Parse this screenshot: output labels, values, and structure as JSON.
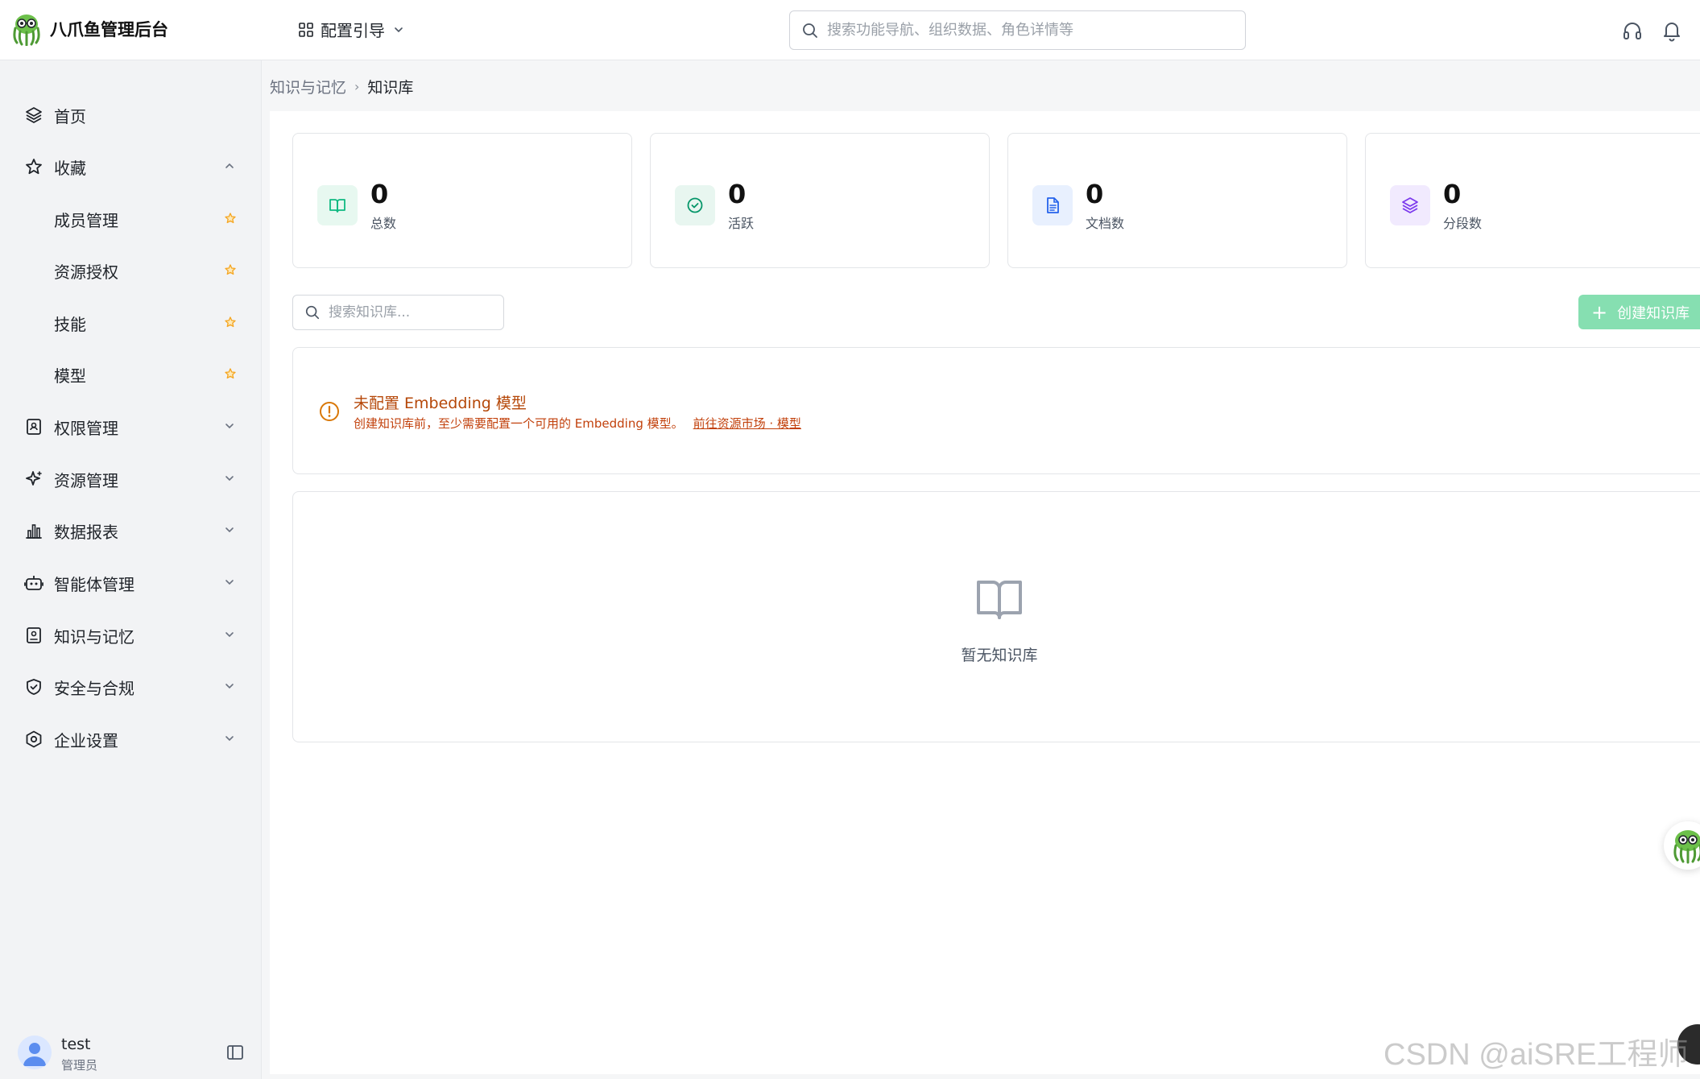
{
  "app": {
    "title": "八爪鱼管理后台",
    "brand_color": "#5cc36b"
  },
  "header": {
    "guide_label": "配置引导",
    "search_placeholder": "搜索功能导航、组织数据、角色详情等",
    "icons": [
      "grid-icon",
      "headset-icon",
      "bell-icon"
    ]
  },
  "sidebar": {
    "items": [
      {
        "label": "首页",
        "icon": "layers-icon"
      },
      {
        "label": "收藏",
        "icon": "star-icon",
        "expanded": true
      },
      {
        "label": "成员管理",
        "sub": true,
        "starred": true
      },
      {
        "label": "资源授权",
        "sub": true,
        "starred": true
      },
      {
        "label": "技能",
        "sub": true,
        "starred": true
      },
      {
        "label": "模型",
        "sub": true,
        "starred": true
      },
      {
        "label": "权限管理",
        "icon": "id-badge-icon"
      },
      {
        "label": "资源管理",
        "icon": "sparkle-icon"
      },
      {
        "label": "数据报表",
        "icon": "bar-chart-icon"
      },
      {
        "label": "智能体管理",
        "icon": "robot-icon"
      },
      {
        "label": "知识与记忆",
        "icon": "knowledge-icon"
      },
      {
        "label": "安全与合规",
        "icon": "shield-icon"
      },
      {
        "label": "企业设置",
        "icon": "hexagon-gear-icon"
      }
    ],
    "user": {
      "name": "test",
      "role": "管理员"
    }
  },
  "breadcrumb": {
    "parent": "知识与记忆",
    "current": "知识库"
  },
  "stats": [
    {
      "value": "0",
      "label": "总数",
      "icon": "book-icon",
      "color": "#10b981",
      "bg": "#e7f8f0"
    },
    {
      "value": "0",
      "label": "活跃",
      "icon": "check-circle-icon",
      "color": "#059669",
      "bg": "#e8f6f0"
    },
    {
      "value": "0",
      "label": "文档数",
      "icon": "document-icon",
      "color": "#2563eb",
      "bg": "#e8f0fe"
    },
    {
      "value": "0",
      "label": "分段数",
      "icon": "layers-icon",
      "color": "#7c3aed",
      "bg": "#f1eafe"
    }
  ],
  "toolbar": {
    "search_placeholder": "搜索知识库...",
    "create_label": "创建知识库",
    "accent": "#86dfb1"
  },
  "warning": {
    "title": "未配置 Embedding 模型",
    "description": "创建知识库前，至少需要配置一个可用的 Embedding 模型。",
    "link": "前往资源市场 · 模型",
    "color": "#c2410c"
  },
  "empty": {
    "text": "暂无知识库"
  },
  "watermark": "CSDN @aiSRE工程师"
}
